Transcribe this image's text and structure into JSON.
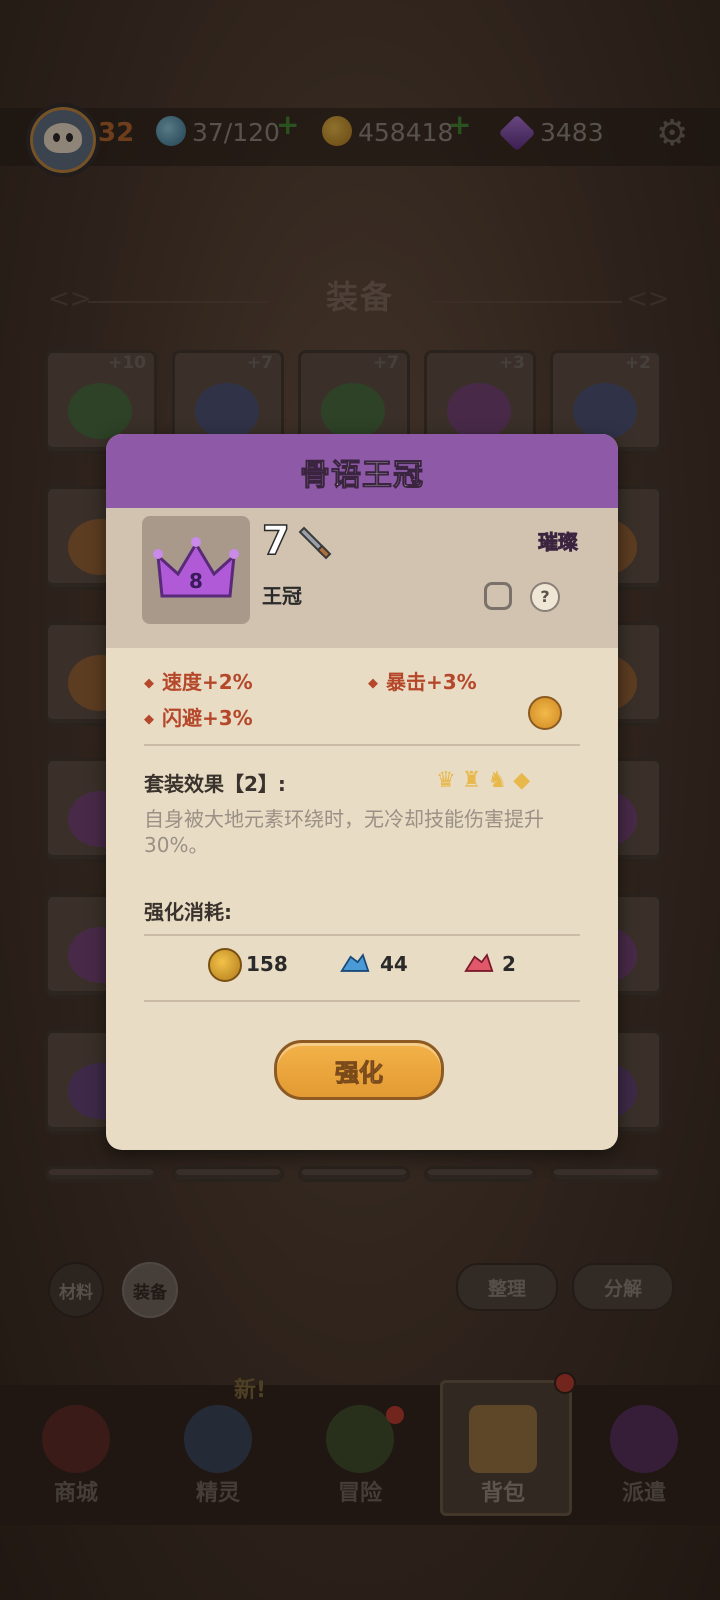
{
  "header": {
    "level": "32",
    "stamina": "37/120",
    "coins": "458418",
    "gems": "3483"
  },
  "section": {
    "title": "装备"
  },
  "equipment_grid": {
    "top_row_plus": [
      "+10",
      "+7",
      "+7",
      "+3",
      "+2"
    ]
  },
  "dialog": {
    "title": "骨语王冠",
    "item_level": "7",
    "item_badge_number": "8",
    "item_type": "王冠",
    "rarity": "璀璨",
    "stats": [
      "速度+2%",
      "暴击+3%",
      "闪避+3%"
    ],
    "set_title": "套装效果【2】:",
    "set_desc": "自身被大地元素环绕时，无冷却技能伤害提升30%。",
    "cost_title": "强化消耗:",
    "costs": [
      {
        "icon": "coin-icon",
        "value": "158"
      },
      {
        "icon": "blue-ore-icon",
        "value": "44"
      },
      {
        "icon": "red-ore-icon",
        "value": "2"
      }
    ],
    "upgrade_label": "强化"
  },
  "tabs": {
    "materials": "材料",
    "equipment": "装备"
  },
  "actions": {
    "sort": "整理",
    "decompose": "分解"
  },
  "nav": {
    "new_badge": "新!",
    "items": [
      "商城",
      "精灵",
      "冒险",
      "背包",
      "派遣"
    ]
  },
  "colors": {
    "dialog_header": "#8e5aa8",
    "accent_orange": "#e39a32",
    "stat_red": "#b5482b"
  }
}
